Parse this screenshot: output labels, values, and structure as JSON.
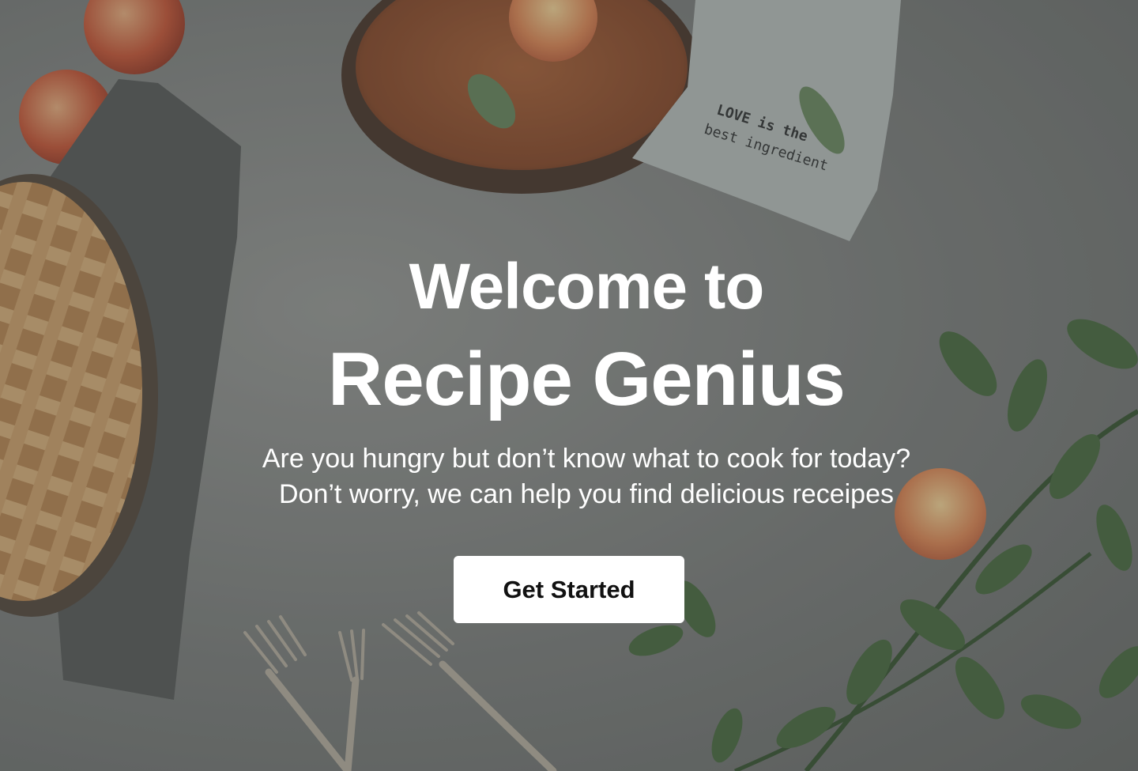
{
  "hero": {
    "heading_line1": "Welcome to",
    "heading_line2": "Recipe Genius",
    "subtitle_line1": "Are you hungry but don’t know what to cook for today?",
    "subtitle_line2": "Don’t worry, we can help you find delicious receipes",
    "cta_label": "Get Started"
  },
  "background": {
    "napkin_text_line1": "LOVE is the",
    "napkin_text_line2": "best ingredient"
  },
  "colors": {
    "text": "#ffffff",
    "button_bg": "#ffffff",
    "button_text": "#111111",
    "surface": "#8a8d8a"
  }
}
